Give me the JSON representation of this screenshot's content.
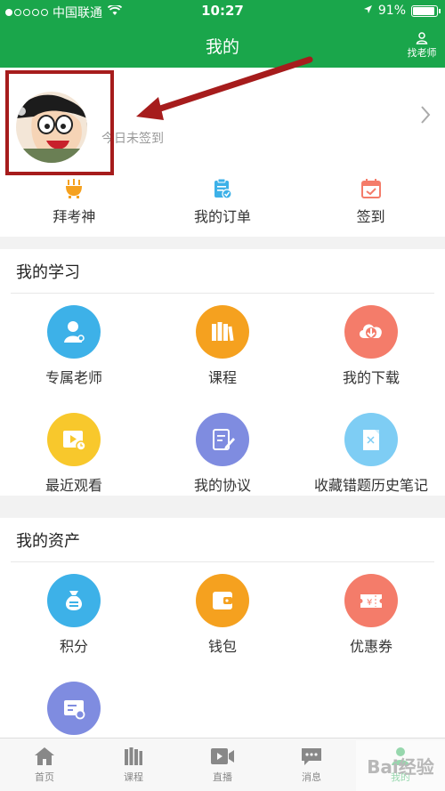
{
  "status_bar": {
    "carrier": "中国联通",
    "time": "10:27",
    "battery": "91%",
    "battery_level": 0.91
  },
  "header": {
    "title": "我的",
    "teacher_label": "找老师"
  },
  "profile": {
    "sign_status": "今日未签到"
  },
  "quick_actions": [
    {
      "label": "拜考神",
      "icon": "incense-burner-icon"
    },
    {
      "label": "我的订单",
      "icon": "order-clipboard-icon"
    },
    {
      "label": "签到",
      "icon": "calendar-check-icon"
    }
  ],
  "study": {
    "title": "我的学习",
    "items": [
      {
        "label": "专属老师",
        "icon": "teacher-icon",
        "color": "#3db1e8"
      },
      {
        "label": "课程",
        "icon": "books-icon",
        "color": "#f5a11f"
      },
      {
        "label": "我的下载",
        "icon": "cloud-download-icon",
        "color": "#f47c6a"
      },
      {
        "label": "最近观看",
        "icon": "video-clock-icon",
        "color": "#f8c82c"
      },
      {
        "label": "我的协议",
        "icon": "document-edit-icon",
        "color": "#7f8ce0"
      },
      {
        "label": "收藏错题历史笔记",
        "icon": "notes-icon",
        "color": "#7ecdf4"
      }
    ]
  },
  "assets": {
    "title": "我的资产",
    "items": [
      {
        "label": "积分",
        "icon": "money-bag-icon",
        "color": "#3db1e8"
      },
      {
        "label": "钱包",
        "icon": "wallet-icon",
        "color": "#f5a11f"
      },
      {
        "label": "优惠券",
        "icon": "coupon-icon",
        "color": "#f47c6a"
      },
      {
        "label": "",
        "icon": "card-settings-icon",
        "color": "#7f8ce0"
      }
    ]
  },
  "tab_bar": [
    {
      "label": "首页",
      "icon": "home-icon"
    },
    {
      "label": "课程",
      "icon": "books-icon"
    },
    {
      "label": "直播",
      "icon": "live-video-icon"
    },
    {
      "label": "消息",
      "icon": "message-icon"
    },
    {
      "label": "我的",
      "icon": "profile-icon"
    }
  ],
  "watermark": "Bai经验",
  "colors": {
    "brand": "#1aa64b",
    "annotation": "#a61c1c"
  }
}
